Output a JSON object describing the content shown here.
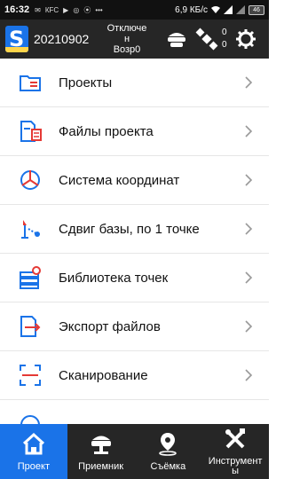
{
  "status": {
    "time": "16:32",
    "notifications": [
      "✉",
      "КFC",
      "▶",
      "◎",
      "⦿",
      "•••"
    ],
    "speed": "6,9 КБ/с",
    "battery": "46"
  },
  "header": {
    "project_code": "20210902",
    "connection_line1": "Отключе",
    "connection_line2": "н",
    "connection_line3": "Возр0",
    "count_top": "0",
    "count_bottom": "0"
  },
  "menu": {
    "items": [
      {
        "label": "Проекты",
        "icon": "folder-list-icon"
      },
      {
        "label": "Файлы проекта",
        "icon": "project-files-icon"
      },
      {
        "label": "Система координат",
        "icon": "coordinate-system-icon"
      },
      {
        "label": "Сдвиг базы, по 1 точке",
        "icon": "base-shift-icon"
      },
      {
        "label": "Библиотека точек",
        "icon": "point-library-icon"
      },
      {
        "label": "Экспорт файлов",
        "icon": "export-files-icon"
      },
      {
        "label": "Сканирование",
        "icon": "scan-icon"
      }
    ]
  },
  "tabs": [
    {
      "label": "Проект",
      "icon": "home-icon",
      "active": true
    },
    {
      "label": "Приемник",
      "icon": "receiver-icon",
      "active": false
    },
    {
      "label": "Съёмка",
      "icon": "survey-pin-icon",
      "active": false
    },
    {
      "label": "Инструмент\nы",
      "icon": "tools-icon",
      "active": false
    }
  ],
  "colors": {
    "accent": "#1a73e8",
    "header_bg": "#262626",
    "icon_red": "#e53935"
  }
}
